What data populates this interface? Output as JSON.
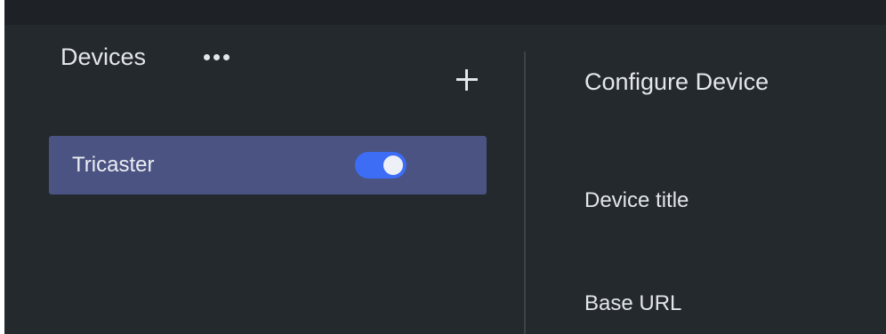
{
  "devices_panel": {
    "title": "Devices",
    "more_icon": "more-horizontal-icon",
    "add_icon": "plus-icon",
    "items": [
      {
        "label": "Tricaster",
        "enabled": true
      }
    ]
  },
  "config_panel": {
    "title": "Configure Device",
    "fields": [
      {
        "label": "Device title"
      },
      {
        "label": "Base URL"
      }
    ]
  },
  "colors": {
    "background": "#24292d",
    "topbar": "#1e2226",
    "selected_item": "#4a5381",
    "toggle_on": "#3d6cf5",
    "text": "#e3e6ea"
  }
}
